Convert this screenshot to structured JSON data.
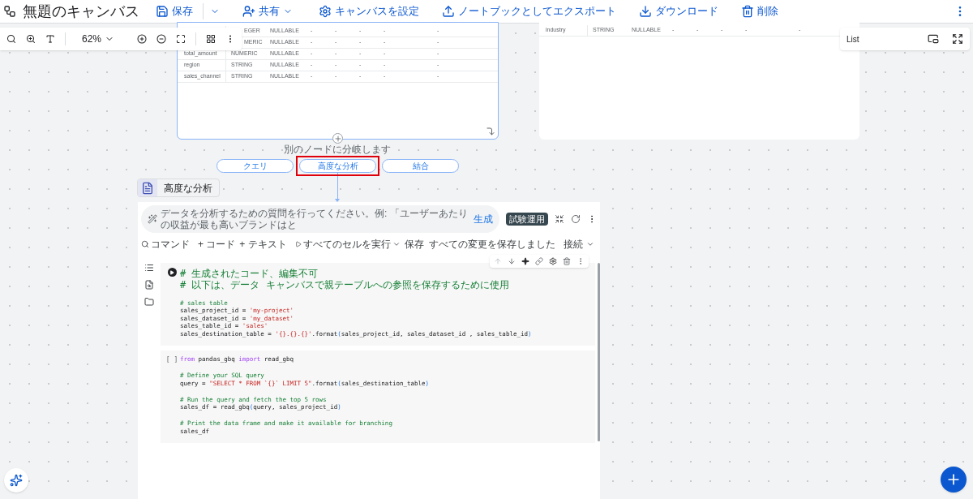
{
  "header": {
    "title": "無題のキャンバス",
    "actions": [
      {
        "kind": "save",
        "label": "保存"
      },
      {
        "kind": "share",
        "label": "共有"
      },
      {
        "kind": "settings",
        "label": "キャンバスを設定"
      },
      {
        "kind": "export",
        "label": "ノートブックとしてエクスポート"
      },
      {
        "kind": "download",
        "label": "ダウンロード"
      },
      {
        "kind": "delete",
        "label": "削除"
      }
    ]
  },
  "zoom_toolbar": {
    "zoom": "62%"
  },
  "schema_left": {
    "rows": [
      {
        "type": "EGER",
        "mode": "NULLABLE",
        "cells": [
          "-",
          "-",
          "-",
          "-",
          "-"
        ]
      },
      {
        "type": "MERIC",
        "mode": "NULLABLE",
        "cells": [
          "-",
          "-",
          "-",
          "-",
          "-"
        ]
      },
      {
        "name": "total_amount",
        "type": "NUMERIC",
        "mode": "NULLABLE",
        "cells": [
          "-",
          "-",
          "-",
          "-",
          "-"
        ]
      },
      {
        "name": "region",
        "type": "STRING",
        "mode": "NULLABLE",
        "cells": [
          "-",
          "-",
          "-",
          "-",
          "-"
        ]
      },
      {
        "name": "sales_channel",
        "type": "STRING",
        "mode": "NULLABLE",
        "cells": [
          "-",
          "-",
          "-",
          "-",
          "-"
        ]
      }
    ]
  },
  "schema_right": {
    "rows": [
      {
        "name": "industry",
        "type": "STRING",
        "mode": "NULLABLE",
        "cells": [
          "-",
          "-",
          "-",
          "-",
          "-"
        ]
      }
    ]
  },
  "list_panel": {
    "title": "List"
  },
  "branch": {
    "label": "別のノードに分岐します",
    "options": [
      {
        "label": "クエリ",
        "selected": false
      },
      {
        "label": "高度な分析",
        "selected": true
      },
      {
        "label": "結合",
        "selected": false
      }
    ]
  },
  "node": {
    "title": "高度な分析"
  },
  "notebook": {
    "prompt": {
      "placeholder": "データを分析するための質問を行ってください。例: 「ユーザーあたりの収益が最も高いブランドはと",
      "generate": "生成",
      "badge": "試験運用"
    },
    "toolbar": {
      "command": "コマンド",
      "code": "+ コード",
      "text": "+ テキスト",
      "run_all": "すべてのセルを実行",
      "save": "保存",
      "status": "すべての変更を保存しました",
      "connect": "接続"
    },
    "cells": [
      {
        "kind": "run_button",
        "lines": [
          {
            "blank_before": false,
            "tokens": [
              {
                "kind": "comment",
                "text": "# 生成されたコード、編集不可"
              }
            ]
          },
          {
            "blank_before": false,
            "tokens": [
              {
                "kind": "comment",
                "text": "# 以下は、データ キャンバスで親テーブルへの参照を保存するために使用"
              }
            ]
          },
          {
            "blank_before": true,
            "tokens": [
              {
                "kind": "comment",
                "text": "# sales table"
              }
            ]
          },
          {
            "blank_before": false,
            "tokens": [
              {
                "kind": "plain",
                "text": "sales_project_id = "
              },
              {
                "kind": "string",
                "text": "'my-project'"
              }
            ]
          },
          {
            "blank_before": false,
            "tokens": [
              {
                "kind": "plain",
                "text": "sales_dataset_id = "
              },
              {
                "kind": "string",
                "text": "'my_dataset'"
              }
            ]
          },
          {
            "blank_before": false,
            "tokens": [
              {
                "kind": "plain",
                "text": "sales_table_id = "
              },
              {
                "kind": "string",
                "text": "'sales'"
              }
            ]
          },
          {
            "blank_before": false,
            "tokens": [
              {
                "kind": "plain",
                "text": "sales_destination_table = "
              },
              {
                "kind": "string",
                "text": "'{}.{}.{}'"
              },
              {
                "kind": "plain",
                "text": ".format"
              },
              {
                "kind": "paren",
                "text": "("
              },
              {
                "kind": "plain",
                "text": "sales_project_id, sales_dataset_id , sales_table_id"
              },
              {
                "kind": "paren",
                "text": ")"
              }
            ]
          }
        ]
      },
      {
        "kind": "brackets",
        "marker": "[ ]",
        "lines": [
          {
            "blank_before": false,
            "tokens": [
              {
                "kind": "keyword",
                "text": "from"
              },
              {
                "kind": "plain",
                "text": " pandas_gbq "
              },
              {
                "kind": "keyword",
                "text": "import"
              },
              {
                "kind": "plain",
                "text": " read_gbq"
              }
            ]
          },
          {
            "blank_before": true,
            "tokens": [
              {
                "kind": "comment",
                "text": "# Define your SQL query"
              }
            ]
          },
          {
            "blank_before": false,
            "tokens": [
              {
                "kind": "plain",
                "text": "query = "
              },
              {
                "kind": "string",
                "text": "\"SELECT * FROM `{}` LIMIT 5\""
              },
              {
                "kind": "plain",
                "text": ".format"
              },
              {
                "kind": "paren",
                "text": "("
              },
              {
                "kind": "plain",
                "text": "sales_destination_table"
              },
              {
                "kind": "paren",
                "text": ")"
              }
            ]
          },
          {
            "blank_before": true,
            "tokens": [
              {
                "kind": "comment",
                "text": "# Run the query and fetch the top 5 rows"
              }
            ]
          },
          {
            "blank_before": false,
            "tokens": [
              {
                "kind": "plain",
                "text": "sales_df = read_gbq"
              },
              {
                "kind": "paren",
                "text": "("
              },
              {
                "kind": "plain",
                "text": "query, sales_project_id"
              },
              {
                "kind": "paren",
                "text": ")"
              }
            ]
          },
          {
            "blank_before": true,
            "tokens": [
              {
                "kind": "comment",
                "text": "# Print the data frame and make it available for branching"
              }
            ]
          },
          {
            "blank_before": false,
            "tokens": [
              {
                "kind": "plain",
                "text": "sales_df"
              }
            ]
          }
        ]
      }
    ]
  }
}
